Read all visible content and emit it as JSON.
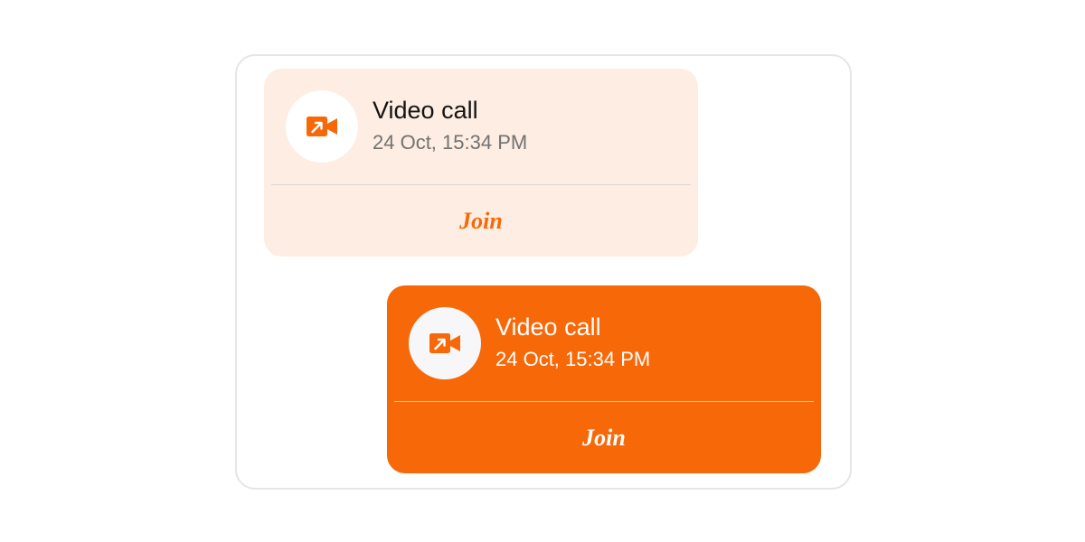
{
  "colors": {
    "accent": "#f76808",
    "incoming_bubble": "#fdede2",
    "outgoing_bubble": "#f76808",
    "icon_circle": "#ffffff"
  },
  "messages": [
    {
      "direction": "incoming",
      "icon": "video-call-icon",
      "title": "Video call",
      "timestamp": "24 Oct, 15:34 PM",
      "action_label": "Join"
    },
    {
      "direction": "outgoing",
      "icon": "video-call-icon",
      "title": "Video call",
      "timestamp": "24 Oct, 15:34 PM",
      "action_label": "Join"
    }
  ]
}
